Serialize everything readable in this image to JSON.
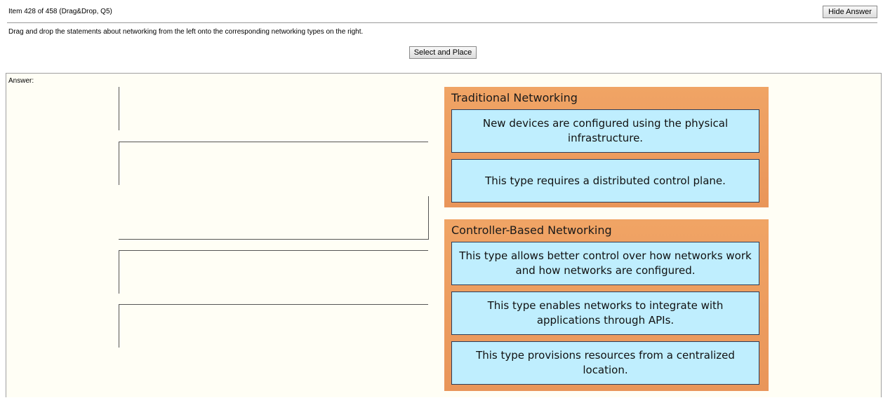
{
  "header": {
    "item_label": "Item 428 of 458  (Drag&Drop, Q5)",
    "hide_answer_label": "Hide Answer"
  },
  "instructions": "Drag and drop the statements about networking from the left onto the corresponding networking types on the right.",
  "select_place_label": "Select and Place",
  "answer_label": "Answer:",
  "groups": [
    {
      "title": "Traditional Networking",
      "items": [
        "New devices are configured using the physical infrastructure.",
        "This type requires a distributed control plane."
      ]
    },
    {
      "title": "Controller-Based Networking",
      "items": [
        "This type allows better control over how networks work and how networks are configured.",
        "This type enables networks to integrate with applications through APIs.",
        "This type provisions resources from a centralized location."
      ]
    }
  ],
  "colors": {
    "group_background": "#f0a465",
    "slot_background": "#bfeefe",
    "slot_border": "#2b3d5a"
  }
}
